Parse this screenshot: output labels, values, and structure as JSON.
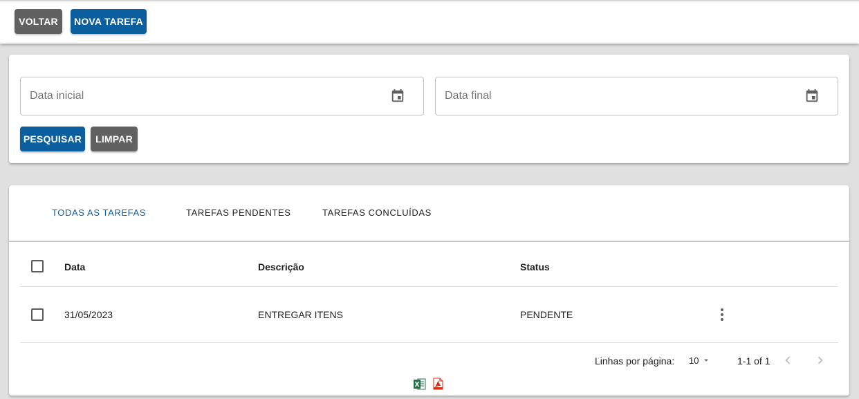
{
  "toolbar": {
    "back_label": "VOLTAR",
    "new_task_label": "NOVA TAREFA"
  },
  "filters": {
    "start_date_placeholder": "Data inicial",
    "end_date_placeholder": "Data final",
    "start_date_value": "",
    "end_date_value": "",
    "search_label": "PESQUISAR",
    "clear_label": "LIMPAR"
  },
  "tabs": [
    {
      "label": "TODAS AS TAREFAS",
      "active": true
    },
    {
      "label": "TAREFAS PENDENTES",
      "active": false
    },
    {
      "label": "TAREFAS CONCLUÍDAS",
      "active": false
    }
  ],
  "table": {
    "columns": [
      "Data",
      "Descrição",
      "Status"
    ],
    "rows": [
      {
        "date": "31/05/2023",
        "description": "ENTREGAR ITENS",
        "status": "PENDENTE"
      }
    ]
  },
  "pagination": {
    "rows_per_page_label": "Linhas por página:",
    "rows_per_page_value": "10",
    "range": "1-1 of 1"
  },
  "export": {
    "excel_icon": "excel-icon",
    "pdf_icon": "pdf-icon"
  },
  "colors": {
    "primary": "#0c5f9f",
    "secondary": "#616161",
    "excel": "#1d7044",
    "pdf": "#d42e12"
  }
}
